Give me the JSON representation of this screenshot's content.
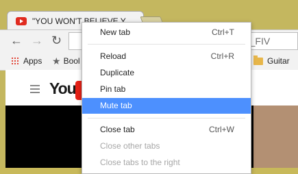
{
  "tab": {
    "title": "\"YOU WON'T BELIEVE Y…"
  },
  "omnibox": {
    "text": "tch?v=_FIV"
  },
  "bookmarks": {
    "apps": "Apps",
    "book": "Bool",
    "guitar": "Guitar"
  },
  "context_menu": {
    "items": [
      {
        "label": "New tab",
        "shortcut": "Ctrl+T",
        "state": "normal"
      },
      {
        "label": "Reload",
        "shortcut": "Ctrl+R",
        "state": "normal"
      },
      {
        "label": "Duplicate",
        "shortcut": "",
        "state": "normal"
      },
      {
        "label": "Pin tab",
        "shortcut": "",
        "state": "normal"
      },
      {
        "label": "Mute tab",
        "shortcut": "",
        "state": "selected"
      },
      {
        "label": "Close tab",
        "shortcut": "Ctrl+W",
        "state": "normal"
      },
      {
        "label": "Close other tabs",
        "shortcut": "",
        "state": "disabled"
      },
      {
        "label": "Close tabs to the right",
        "shortcut": "",
        "state": "disabled"
      }
    ]
  },
  "colors": {
    "selection": "#4d90fe",
    "youtube_red": "#e62117"
  }
}
